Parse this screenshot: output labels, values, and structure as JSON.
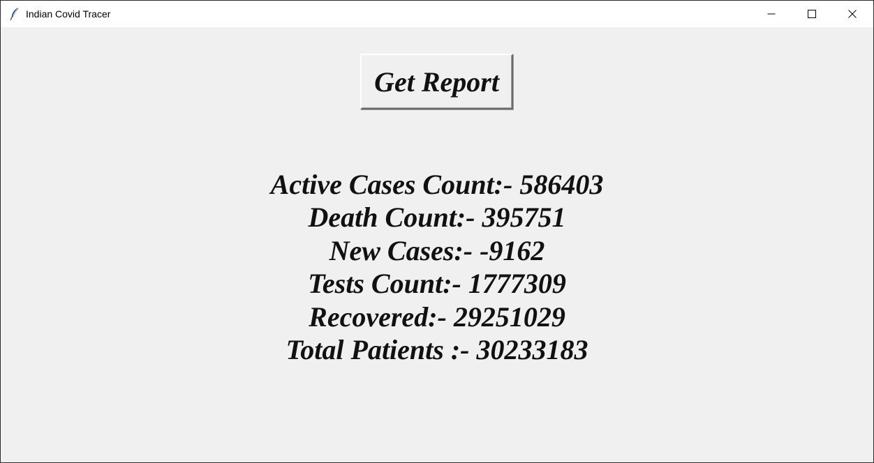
{
  "window": {
    "title": "Indian Covid Tracer",
    "app_icon": "feather-icon",
    "controls": [
      "minimize-icon",
      "maximize-icon",
      "close-icon"
    ]
  },
  "main": {
    "report_button_label": "Get Report",
    "stats": [
      "Active Cases Count:- 586403",
      "Death Count:- 395751",
      "New Cases:- -9162",
      "Tests Count:- 1777309",
      "Recovered:- 29251029",
      "Total Patients :- 30233183"
    ]
  },
  "colors": {
    "window_background": "#f0f0f0",
    "titlebar_background": "#ffffff",
    "text": "#111111"
  }
}
